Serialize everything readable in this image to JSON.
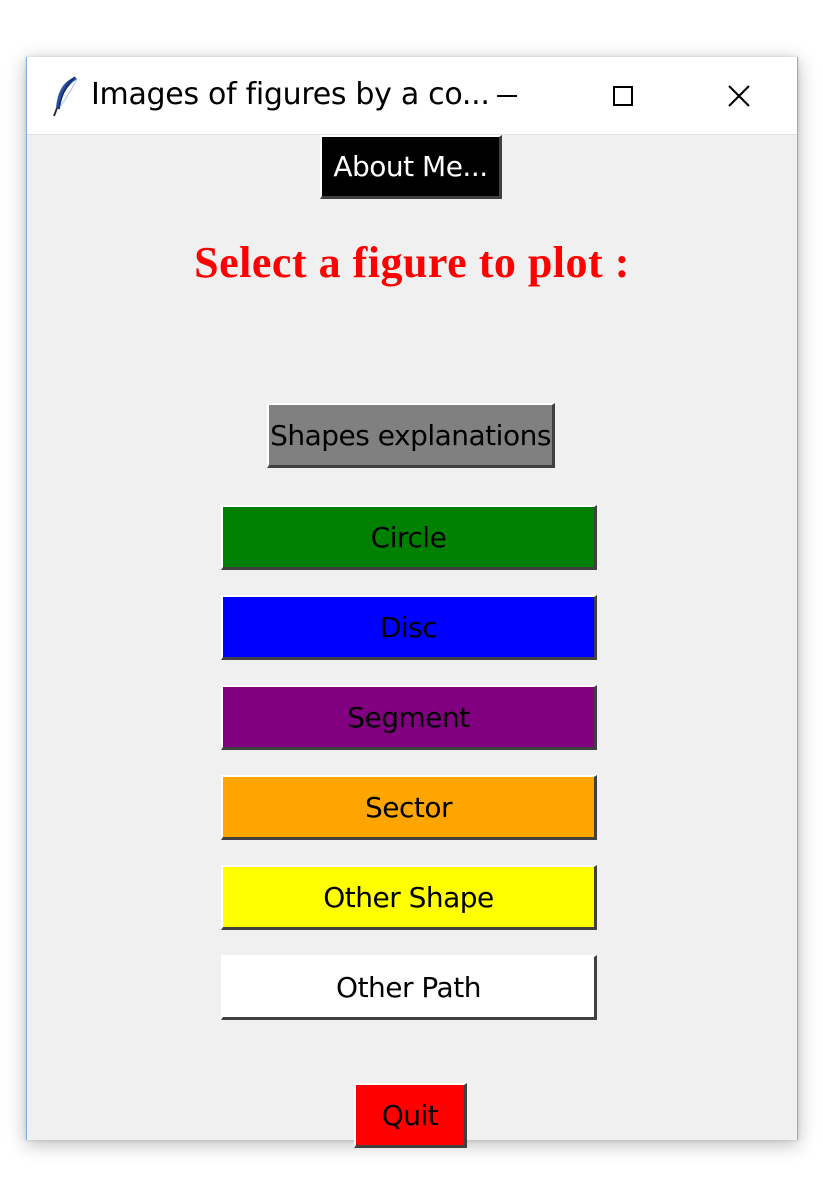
{
  "window": {
    "title": "Images of figures by a co...",
    "controls": {
      "minimize_icon": "minimize-icon",
      "maximize_icon": "maximize-icon",
      "close_icon": "close-icon"
    }
  },
  "about_button": {
    "label": "About Me...",
    "bg": "#000000",
    "fg": "#ffffff"
  },
  "heading": {
    "text": "Select a figure to plot :",
    "color": "#ff0000"
  },
  "explanations_button": {
    "label": "Shapes explanations",
    "bg": "#808080",
    "fg": "#000000"
  },
  "shape_buttons": [
    {
      "label": "Circle",
      "bg": "#008000",
      "fg": "#000000"
    },
    {
      "label": "Disc",
      "bg": "#0000ff",
      "fg": "#000000"
    },
    {
      "label": "Segment",
      "bg": "#800080",
      "fg": "#000000"
    },
    {
      "label": "Sector",
      "bg": "#ffa500",
      "fg": "#000000"
    },
    {
      "label": "Other Shape",
      "bg": "#ffff00",
      "fg": "#000000"
    },
    {
      "label": "Other Path",
      "bg": "#ffffff",
      "fg": "#000000"
    }
  ],
  "quit_button": {
    "label": "Quit",
    "bg": "#ff0000",
    "fg": "#000000"
  }
}
